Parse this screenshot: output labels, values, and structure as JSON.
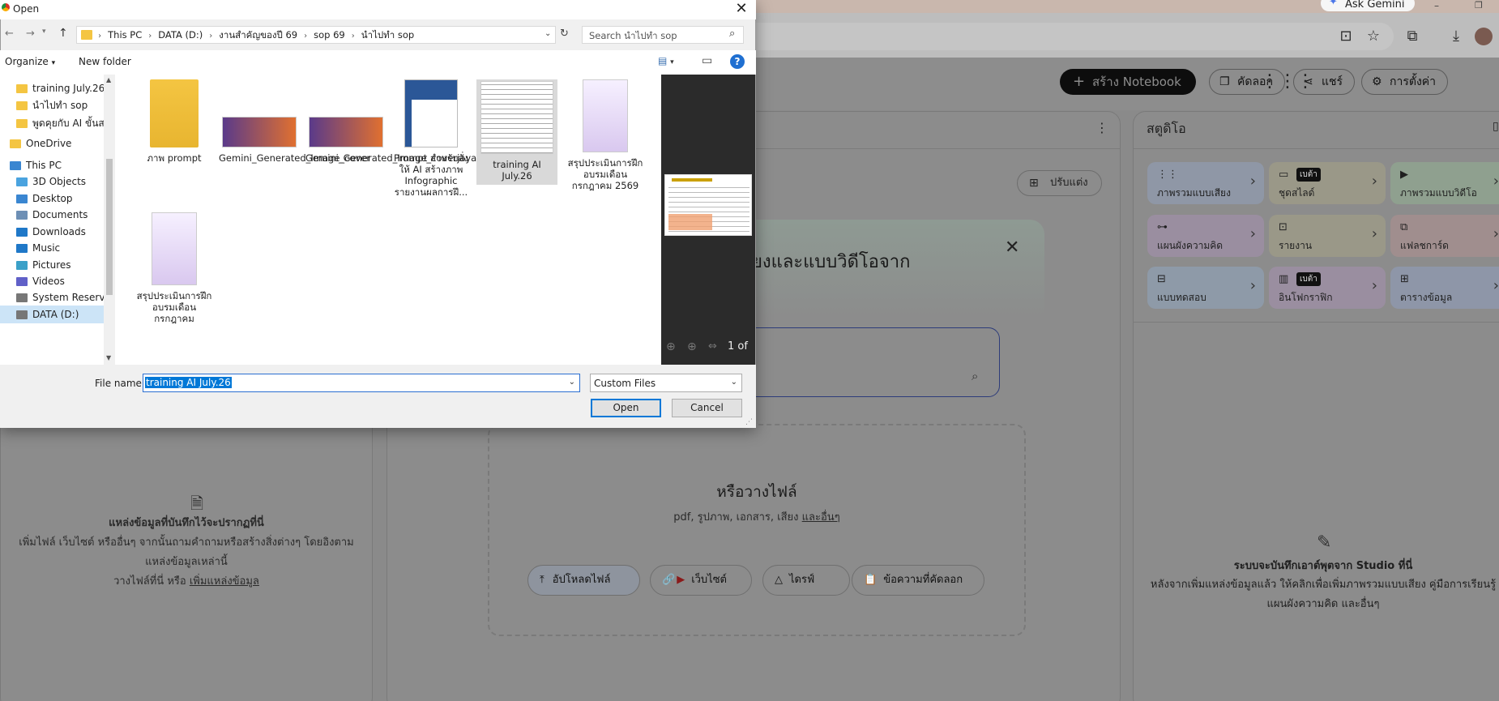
{
  "browser": {
    "ask_gemini": "Ask Gemini"
  },
  "notebook": {
    "create_label": "สร้าง Notebook",
    "copy_label": "คัดลอก",
    "share_label": "แชร์",
    "settings_label": "การตั้งค่า",
    "left_empty": {
      "title": "แหล่งข้อมูลที่บันทึกไว้จะปรากฏที่นี่",
      "line1": "เพิ่มไฟล์ เว็บไซต์ หรืออื่นๆ จากนั้นถามคำถามหรือสร้างสิ่งต่างๆ โดยอิงตาม",
      "line2": "แหล่งข้อมูลเหล่านี้",
      "line3": "วางไฟล์ที่นี่ หรือ",
      "line3_link": "เพิ่มแหล่งข้อมูล"
    },
    "customize_label": "ปรับแต่ง",
    "studio_title": "สตูดิโอ",
    "studio_cards": [
      {
        "label": "ภาพรวมแบบเสียง",
        "color": "#8f97a6"
      },
      {
        "label": "ชุดสไลด์",
        "color": "#9a9888",
        "beta": "เบต้า"
      },
      {
        "label": "ภาพรวมแบบวิดีโอ",
        "color": "#8fa08f"
      },
      {
        "label": "แผนผังความคิด",
        "color": "#9a8ea0"
      },
      {
        "label": "รายงาน",
        "color": "#9a9888"
      },
      {
        "label": "แฟลชการ์ด",
        "color": "#a08e8e"
      },
      {
        "label": "แบบทดสอบ",
        "color": "#8e9aa8"
      },
      {
        "label": "อินโฟกราฟิก",
        "color": "#9a8ea0",
        "beta": "เบต้า"
      },
      {
        "label": "ตารางข้อมูล",
        "color": "#8e96a8"
      }
    ],
    "studio_empty": {
      "title": "ระบบจะบันทึกเอาต์พุตจาก Studio ที่นี่",
      "line1": "หลังจากเพิ่มแหล่งข้อมูลแล้ว ให้คลิกเพื่อเพิ่มภาพรวมแบบเสียง คู่มือการเรียนรู้",
      "line2": "แผนผังความคิด และอื่นๆ"
    }
  },
  "modal": {
    "title": "ยงและแบบวิดีโอจาก",
    "drop_title": "หรือวางไฟล์",
    "drop_sub": "pdf, รูปภาพ, เอกสาร, เสียง",
    "drop_sub_link": "และอื่นๆ",
    "buttons": {
      "upload": "อัปโหลดไฟล์",
      "website": "เว็บไซต์",
      "drive": "ไดรฟ์",
      "copied": "ข้อความที่คัดลอก"
    }
  },
  "dialog": {
    "title": "Open",
    "path": [
      "This PC",
      "DATA (D:)",
      "งานสำคัญของปี 69",
      "sop 69",
      "นำไปทำ sop"
    ],
    "search_placeholder": "Search นำไปทำ sop",
    "organize": "Organize",
    "new_folder": "New folder",
    "nav": [
      {
        "label": "training July.26",
        "kind": "folder"
      },
      {
        "label": "นำไปทำ sop",
        "kind": "folder"
      },
      {
        "label": "พูดคุยกับ AI ขั้นสอ",
        "kind": "folder"
      },
      {
        "label": "OneDrive",
        "kind": "folder"
      },
      {
        "label": "This PC",
        "kind": "pc"
      },
      {
        "label": "3D Objects",
        "kind": "cube"
      },
      {
        "label": "Desktop",
        "kind": "desktop"
      },
      {
        "label": "Documents",
        "kind": "doc"
      },
      {
        "label": "Downloads",
        "kind": "down"
      },
      {
        "label": "Music",
        "kind": "music"
      },
      {
        "label": "Pictures",
        "kind": "pic"
      },
      {
        "label": "Videos",
        "kind": "video"
      },
      {
        "label": "System Reserved",
        "kind": "drive"
      },
      {
        "label": "DATA (D:)",
        "kind": "drive"
      }
    ],
    "files": [
      {
        "label": "ภาพ prompt"
      },
      {
        "label": "Gemini_Generated_Image_cover"
      },
      {
        "label": "Gemini_Generated_Image_coverjaya"
      },
      {
        "label": "Prompt สำหรับสั่งให้ AI สร้างภาพ Infographic รายงานผลการฝึ..."
      },
      {
        "label": "training AI July.26"
      },
      {
        "label": "สรุปประเมินการฝึกอบรมเดือนกรกฎาคม 2569"
      },
      {
        "label": "สรุปประเมินการฝึกอบรมเดือนกรกฎาคม"
      }
    ],
    "preview_page": "1 of",
    "file_name_label": "File name:",
    "file_name_value": "training AI July.26",
    "file_type": "Custom Files",
    "open_label": "Open",
    "cancel_label": "Cancel"
  }
}
